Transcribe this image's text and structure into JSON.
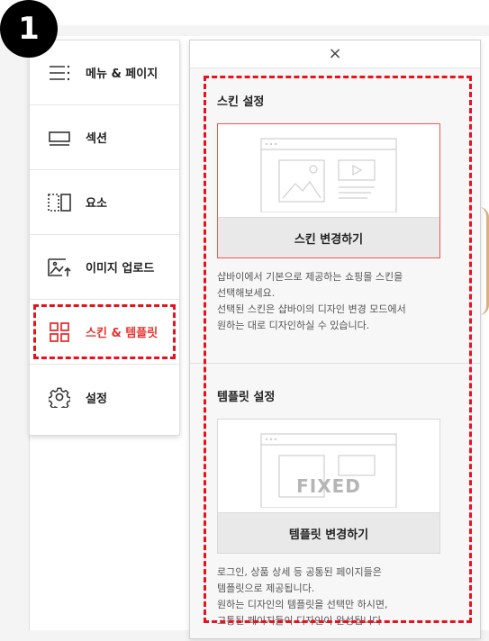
{
  "step_badge": "1",
  "menu": {
    "items": [
      {
        "label": "메뉴 & 페이지",
        "icon": "menu-lines-icon",
        "active": false
      },
      {
        "label": "섹션",
        "icon": "section-icon",
        "active": false
      },
      {
        "label": "요소",
        "icon": "element-icon",
        "active": false
      },
      {
        "label": "이미지 업로드",
        "icon": "image-upload-icon",
        "active": false
      },
      {
        "label": "스킨 & 템플릿",
        "icon": "grid-icon",
        "active": true
      },
      {
        "label": "설정",
        "icon": "gear-icon",
        "active": false
      }
    ],
    "active_color": "#e8322f"
  },
  "panel": {
    "close_label": "×",
    "skin": {
      "title": "스킨 설정",
      "button": "스킨 변경하기",
      "desc_lines": [
        "샵바이에서 기본으로 제공하는 쇼핑몰 스킨을",
        "선택해보세요.",
        "선택된 스킨은 샵바이의 디자인 변경 모드에서",
        "원하는 대로 디자인하실 수 있습니다."
      ]
    },
    "template": {
      "title": "템플릿 설정",
      "overlay": "FIXED",
      "button": "템플릿 변경하기",
      "desc_lines": [
        "로그인, 상품 상세 등 공통된 페이지들은",
        "템플릿으로 제공됩니다.",
        "원하는 디자인의 템플릿을 선택만 하시면,",
        "고통된 페이지들이 디자인이 완성됩니다"
      ]
    }
  },
  "highlight_color": "#e8121d"
}
